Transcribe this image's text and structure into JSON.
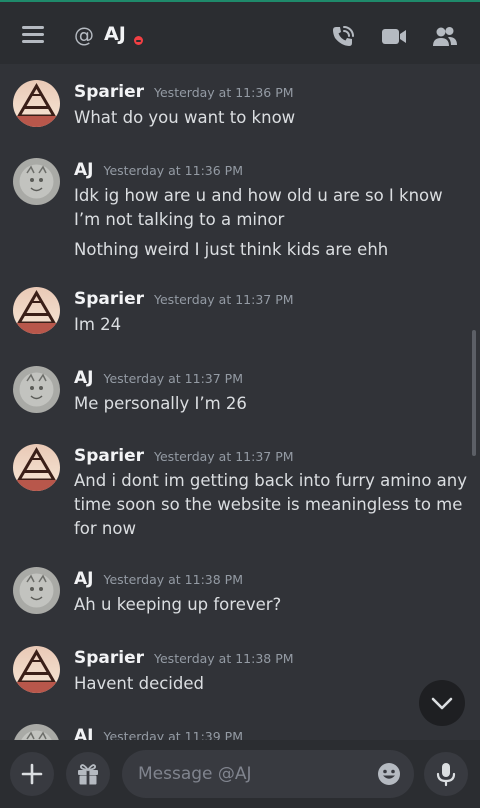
{
  "header": {
    "title": "AJ",
    "at_symbol": "@"
  },
  "messages": [
    {
      "author": "Sparier",
      "time": "Yesterday at 11:36 PM",
      "avatar": "sparier-avatar",
      "lines": [
        "What do you want to know"
      ]
    },
    {
      "author": "AJ",
      "time": "Yesterday at 11:36 PM",
      "avatar": "aj-avatar",
      "lines": [
        "Idk ig how are u and how old u are so I know I’m not talking to a minor",
        "Nothing weird I just think kids are ehh"
      ]
    },
    {
      "author": "Sparier",
      "time": "Yesterday at 11:37 PM",
      "avatar": "sparier-avatar",
      "lines": [
        "Im 24"
      ]
    },
    {
      "author": "AJ",
      "time": "Yesterday at 11:37 PM",
      "avatar": "aj-avatar",
      "lines": [
        "Me personally I’m 26"
      ]
    },
    {
      "author": "Sparier",
      "time": "Yesterday at 11:37 PM",
      "avatar": "sparier-avatar",
      "lines": [
        "And i dont im getting back into furry amino any time soon so the website is meaningless to me for now"
      ]
    },
    {
      "author": "AJ",
      "time": "Yesterday at 11:38 PM",
      "avatar": "aj-avatar",
      "lines": [
        "Ah u keeping up forever?"
      ]
    },
    {
      "author": "Sparier",
      "time": "Yesterday at 11:38 PM",
      "avatar": "sparier-avatar",
      "lines": [
        "Havent decided"
      ]
    },
    {
      "author": "AJ",
      "time": "Yesterday at 11:39 PM",
      "avatar": "aj-avatar",
      "lines": []
    }
  ],
  "composer": {
    "placeholder": "Message @AJ"
  },
  "icons": {
    "menu": "hamburger-menu-icon",
    "call": "phone-call-icon",
    "video": "video-camera-icon",
    "members": "members-icon",
    "add": "plus-icon",
    "gift": "gift-icon",
    "emoji": "emoji-icon",
    "mic": "microphone-icon",
    "jump": "chevron-down-icon"
  },
  "colors": {
    "background": "#313338",
    "header": "#2b2d31",
    "status_dnd": "#f23f43",
    "accent_top": "#1f8a6b"
  }
}
